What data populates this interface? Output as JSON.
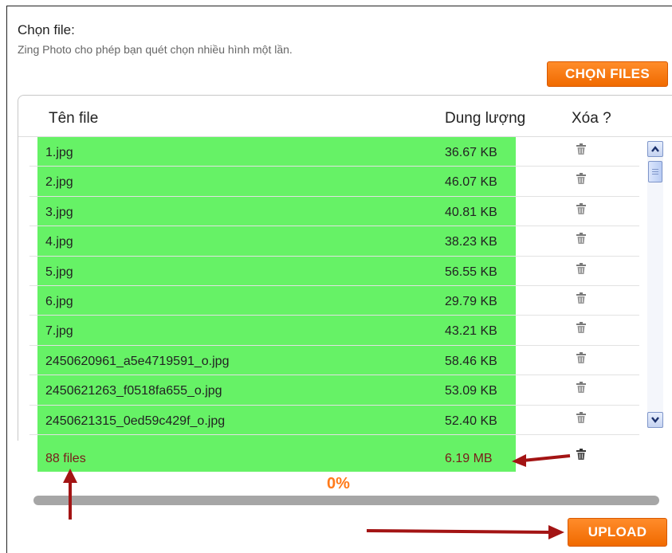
{
  "header": {
    "title": "Chọn file:",
    "description": "Zing Photo cho phép bạn quét chọn nhiều hình một lần.",
    "choose_button": "CHỌN FILES"
  },
  "table": {
    "columns": [
      "Tên file",
      "Dung lượng",
      "Xóa ?"
    ],
    "rows": [
      {
        "name": "1.jpg",
        "size": "36.67 KB"
      },
      {
        "name": "2.jpg",
        "size": "46.07 KB"
      },
      {
        "name": "3.jpg",
        "size": "40.81 KB"
      },
      {
        "name": "4.jpg",
        "size": "38.23 KB"
      },
      {
        "name": "5.jpg",
        "size": "56.55 KB"
      },
      {
        "name": "6.jpg",
        "size": "29.79 KB"
      },
      {
        "name": "7.jpg",
        "size": "43.21 KB"
      },
      {
        "name": "2450620961_a5e4719591_o.jpg",
        "size": "58.46 KB"
      },
      {
        "name": "2450621263_f0518fa655_o.jpg",
        "size": "53.09 KB"
      },
      {
        "name": "2450621315_0ed59c429f_o.jpg",
        "size": "52.40 KB"
      }
    ],
    "delete_icon": "trash-icon"
  },
  "summary": {
    "count": "88 files",
    "total_size": "6.19 MB"
  },
  "progress": {
    "label": "0%",
    "value": 0
  },
  "upload_button": "UPLOAD",
  "colors": {
    "accent": "#f06a00",
    "highlight": "#66f266",
    "annotation_arrow": "#a31414",
    "progress_track": "#a6a6a6"
  }
}
